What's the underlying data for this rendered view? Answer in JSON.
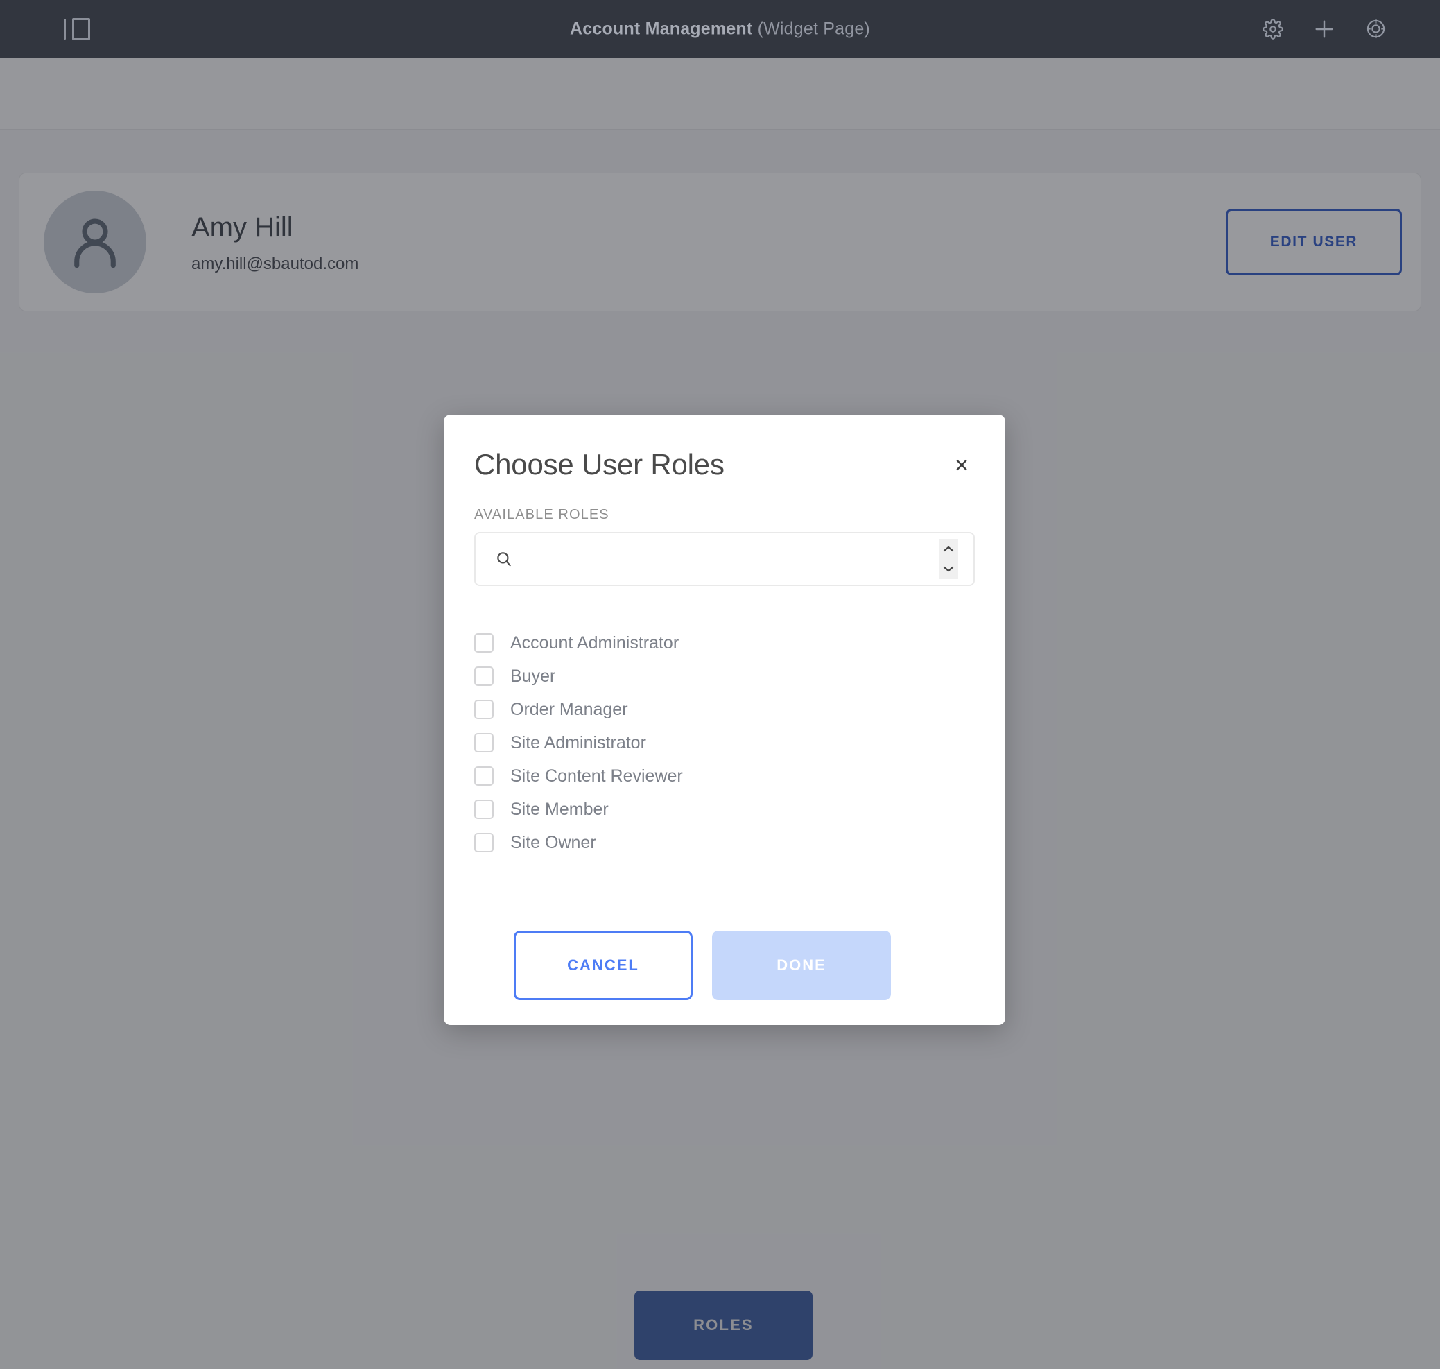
{
  "appbar": {
    "panel_toggle_name": "panel-toggle-icon",
    "title_strong": "Account Management",
    "title_muted": "(Widget Page)",
    "actions": [
      "gear-icon",
      "plus-icon",
      "target-icon"
    ]
  },
  "user_card": {
    "avatar_icon": "user-avatar-icon",
    "name": "Amy Hill",
    "email": "amy.hill@sbautod.com",
    "edit_button_label": "EDIT USER"
  },
  "page": {
    "roles_button_label": "ROLES"
  },
  "modal": {
    "title": "Choose User Roles",
    "close_label": "×",
    "field_label": "AVAILABLE ROLES",
    "search": {
      "value": "",
      "placeholder": "",
      "icon": "search-icon",
      "spinner_up_icon": "chevron-up-icon",
      "spinner_down_icon": "chevron-down-icon"
    },
    "roles": [
      {
        "label": "Account Administrator",
        "checked": false
      },
      {
        "label": "Buyer",
        "checked": false
      },
      {
        "label": "Order Manager",
        "checked": false
      },
      {
        "label": "Site Administrator",
        "checked": false
      },
      {
        "label": "Site Content Reviewer",
        "checked": false
      },
      {
        "label": "Site Member",
        "checked": false
      },
      {
        "label": "Site Owner",
        "checked": false
      }
    ],
    "cancel_label": "CANCEL",
    "done_label": "DONE",
    "done_disabled": true
  },
  "colors": {
    "appbar_bg": "#32363f",
    "accent_blue": "#2f59c9",
    "button_blue": "#4d7cf5",
    "done_disabled_bg": "#c5d7fb",
    "roles_button_bg": "#3a5ba0",
    "overlay": "rgba(36,39,46,0.47)"
  }
}
